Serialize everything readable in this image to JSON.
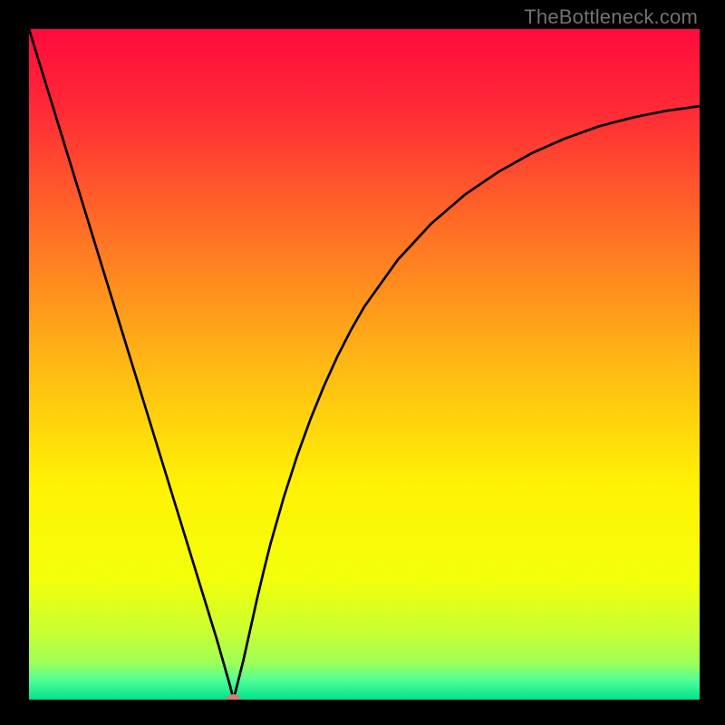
{
  "watermark": "TheBottleneck.com",
  "chart_data": {
    "type": "line",
    "title": "",
    "xlabel": "",
    "ylabel": "",
    "xlim": [
      0,
      100
    ],
    "ylim": [
      0,
      100
    ],
    "grid": false,
    "axes_visible": false,
    "background": {
      "type": "vertical-gradient",
      "stops": [
        {
          "offset": 0.0,
          "color": "#ff0b3e"
        },
        {
          "offset": 0.12,
          "color": "#ff2a36"
        },
        {
          "offset": 0.3,
          "color": "#ff6f26"
        },
        {
          "offset": 0.5,
          "color": "#ffb814"
        },
        {
          "offset": 0.68,
          "color": "#fff205"
        },
        {
          "offset": 0.82,
          "color": "#f4ff0a"
        },
        {
          "offset": 0.9,
          "color": "#c8ff33"
        },
        {
          "offset": 0.945,
          "color": "#9fff58"
        },
        {
          "offset": 0.97,
          "color": "#54ff95"
        },
        {
          "offset": 1.0,
          "color": "#00e28e"
        }
      ]
    },
    "min_point": {
      "x": 30.5,
      "y": 0,
      "marker_color": "#d57f73"
    },
    "series": [
      {
        "name": "bottleneck-curve",
        "color": "#000000",
        "stroke_width": 2.7,
        "x": [
          0,
          2,
          4,
          6,
          8,
          10,
          12,
          14,
          16,
          18,
          20,
          22,
          24,
          26,
          28,
          29,
          30,
          30.5,
          31,
          32,
          33,
          34,
          35,
          36,
          38,
          40,
          42,
          44,
          46,
          48,
          50,
          55,
          60,
          65,
          70,
          75,
          80,
          85,
          90,
          95,
          100
        ],
        "y": [
          100,
          93.5,
          87,
          80.5,
          74,
          67.5,
          61,
          54.5,
          48,
          41.5,
          35,
          28.5,
          22,
          15.5,
          9,
          5.5,
          2,
          0,
          2,
          6,
          10.5,
          15,
          19.2,
          23.2,
          30.2,
          36.4,
          41.9,
          46.8,
          51.2,
          55.1,
          58.6,
          65.6,
          71.0,
          75.3,
          78.7,
          81.5,
          83.7,
          85.5,
          86.8,
          87.8,
          88.5
        ]
      }
    ]
  }
}
